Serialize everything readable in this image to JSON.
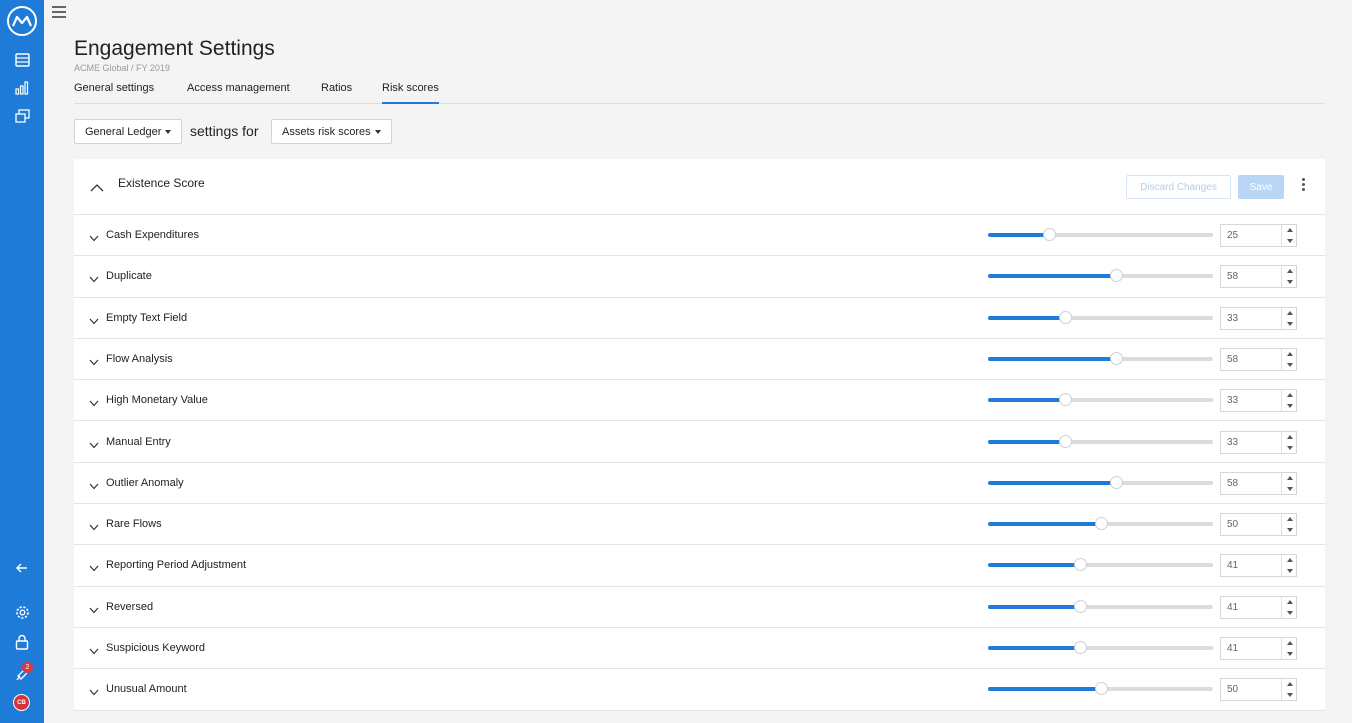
{
  "header": {
    "title": "Engagement Settings",
    "breadcrumb": "ACME Global / FY 2019"
  },
  "tabs": [
    {
      "label": "General settings",
      "active": false
    },
    {
      "label": "Access management",
      "active": false
    },
    {
      "label": "Ratios",
      "active": false
    },
    {
      "label": "Risk scores",
      "active": true
    }
  ],
  "filters": {
    "ledger": "General Ledger",
    "connector": "settings for",
    "scoreType": "Assets risk scores"
  },
  "section": {
    "title": "Existence Score",
    "discard_label": "Discard Changes",
    "save_label": "Save"
  },
  "slider_range": [
    0,
    100
  ],
  "rows": [
    {
      "label": "Cash Expenditures",
      "value": "25",
      "level": 0.27
    },
    {
      "label": "Duplicate",
      "value": "58",
      "level": 0.57
    },
    {
      "label": "Empty Text Field",
      "value": "33",
      "level": 0.34
    },
    {
      "label": "Flow Analysis",
      "value": "58",
      "level": 0.57
    },
    {
      "label": "High Monetary Value",
      "value": "33",
      "level": 0.34
    },
    {
      "label": "Manual Entry",
      "value": "33",
      "level": 0.34
    },
    {
      "label": "Outlier Anomaly",
      "value": "58",
      "level": 0.57
    },
    {
      "label": "Rare Flows",
      "value": "50",
      "level": 0.5
    },
    {
      "label": "Reporting Period Adjustment",
      "value": "41",
      "level": 0.41
    },
    {
      "label": "Reversed",
      "value": "41",
      "level": 0.41
    },
    {
      "label": "Suspicious Keyword",
      "value": "41",
      "level": 0.41
    },
    {
      "label": "Unusual Amount",
      "value": "50",
      "level": 0.5
    }
  ],
  "sidebar": {
    "icons": [
      "table-icon",
      "bar-chart-icon",
      "layers-icon",
      "collapse-arrow-icon",
      "gear-icon",
      "lock-icon",
      "rocket-icon"
    ],
    "notification_count": "2",
    "avatar_initials": "CB"
  },
  "colors": {
    "accent": "#1f7bd8",
    "save_disabled": "#b9d6f6"
  }
}
